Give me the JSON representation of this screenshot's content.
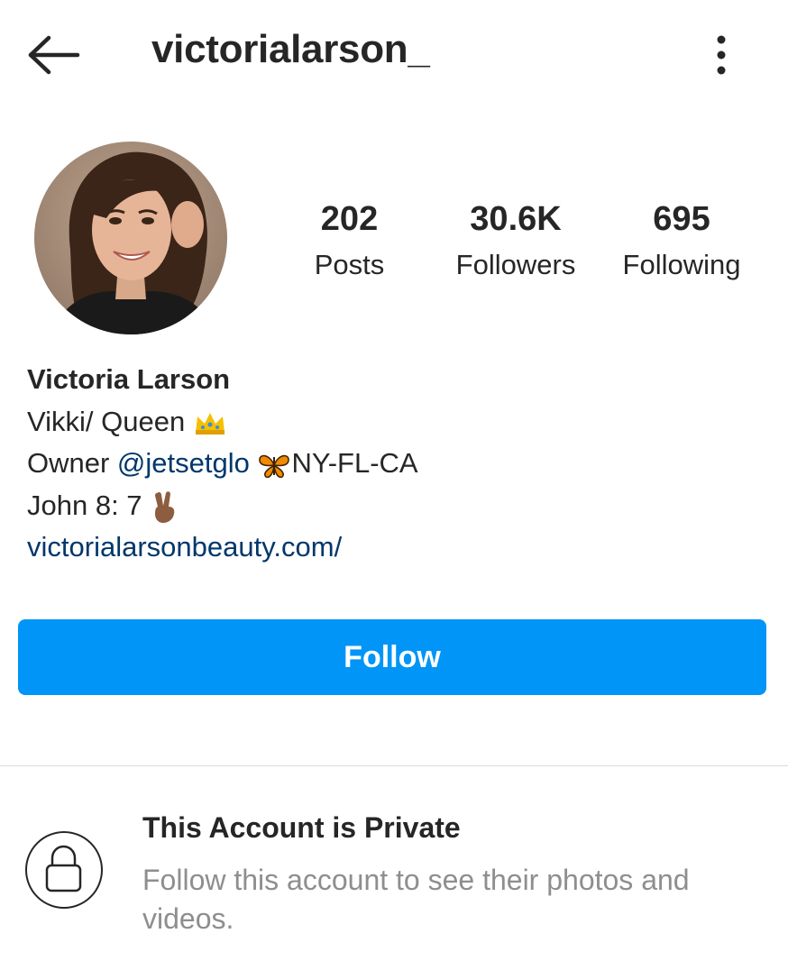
{
  "header": {
    "username": "victorialarson_",
    "back_icon": "arrow-left-icon",
    "more_icon": "vertical-dots-icon"
  },
  "profile": {
    "avatar_icon": "profile-photo",
    "stats": [
      {
        "value": "202",
        "label": "Posts"
      },
      {
        "value": "30.6K",
        "label": "Followers"
      },
      {
        "value": "695",
        "label": "Following"
      }
    ]
  },
  "bio": {
    "name": "Victoria Larson",
    "line1": "Vikki/ Queen",
    "line1_emoji": "crown-emoji",
    "line2_prefix": "Owner ",
    "line2_mention": "@jetsetglo",
    "line2_emoji": "butterfly-emoji",
    "line2_suffix": "NY-FL-CA",
    "line3": "John 8: 7",
    "line3_emoji": "victory-hand-emoji",
    "website": "victorialarsonbeauty.com/"
  },
  "actions": {
    "follow_label": "Follow"
  },
  "private_notice": {
    "icon": "lock-icon",
    "title": "This Account is Private",
    "subtitle": "Follow this account to see their photos and videos."
  },
  "colors": {
    "accent": "#0095f6",
    "link": "#00376b",
    "text": "#262626",
    "muted": "#8e8e8e",
    "divider": "#dbdbdb"
  }
}
